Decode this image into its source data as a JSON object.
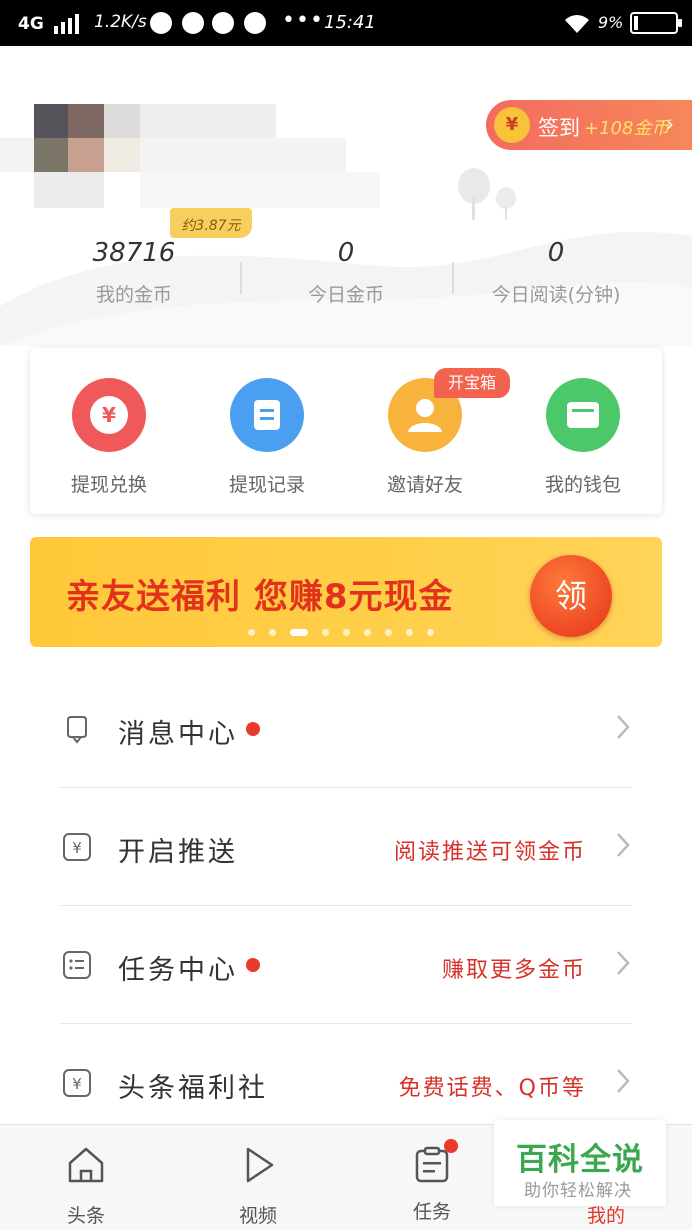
{
  "status_bar": {
    "network": "4G",
    "speed": "1.2K/s",
    "more": "•••",
    "time": "15:41",
    "battery": "9%"
  },
  "profile": {
    "signin_coin_icon": "¥",
    "signin_label": "签到",
    "signin_coins": "+108金币",
    "signin_arrow": "›",
    "yuan_badge": "约3.87元",
    "stats": [
      {
        "value": "38716",
        "label": "我的金币"
      },
      {
        "value": "0",
        "label": "今日金币"
      },
      {
        "value": "0",
        "label": "今日阅读(分钟)"
      }
    ]
  },
  "shortcuts": {
    "items": [
      {
        "label": "提现兑换",
        "icon": "yen-icon",
        "color": "#f0595a"
      },
      {
        "label": "提现记录",
        "icon": "record-icon",
        "color": "#4a9ff0"
      },
      {
        "label": "邀请好友",
        "icon": "friend-icon",
        "color": "#f7b33b"
      },
      {
        "label": "我的钱包",
        "icon": "wallet-icon",
        "color": "#4cc76a"
      }
    ],
    "tag": "开宝箱"
  },
  "banner": {
    "text": "亲友送福利 您赚8元现金",
    "button": "领",
    "active_dot": 2,
    "dot_count": 9
  },
  "menu": [
    {
      "label": "消息中心",
      "hint": "",
      "icon": "bell-icon",
      "dot": true
    },
    {
      "label": "开启推送",
      "hint": "阅读推送可领金币",
      "icon": "yen-box-icon",
      "dot": false
    },
    {
      "label": "任务中心",
      "hint": "赚取更多金币",
      "icon": "task-list-icon",
      "dot": true
    },
    {
      "label": "头条福利社",
      "hint": "免费话费、Q币等",
      "icon": "yen-box-icon",
      "dot": false
    }
  ],
  "nav": {
    "items": [
      {
        "label": "头条",
        "icon": "home-icon"
      },
      {
        "label": "视频",
        "icon": "play-icon"
      },
      {
        "label": "任务",
        "icon": "task-icon"
      },
      {
        "label": "我的",
        "icon": "profile-icon"
      }
    ],
    "active_color": "#e8392b"
  },
  "watermark": {
    "title": "百科全说",
    "subtitle": "助你轻松解决"
  }
}
